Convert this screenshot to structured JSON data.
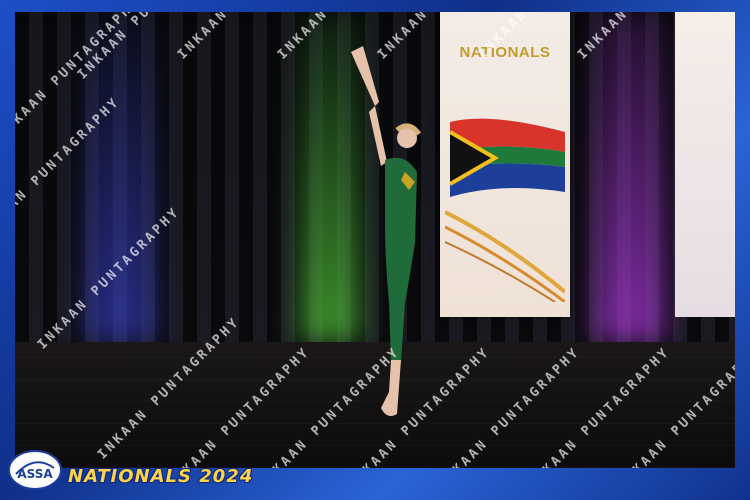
{
  "banner": {
    "title": "NATIONALS"
  },
  "watermark": {
    "text": "INKAAN PUNTAGRAPHY"
  },
  "footer": {
    "logo_text": "ASSA",
    "title": "NATIONALS 2024"
  },
  "colors": {
    "frame_blue": "#1e4fc8",
    "accent_gold": "#ffd24a",
    "leotard_green": "#1f6b3a"
  }
}
